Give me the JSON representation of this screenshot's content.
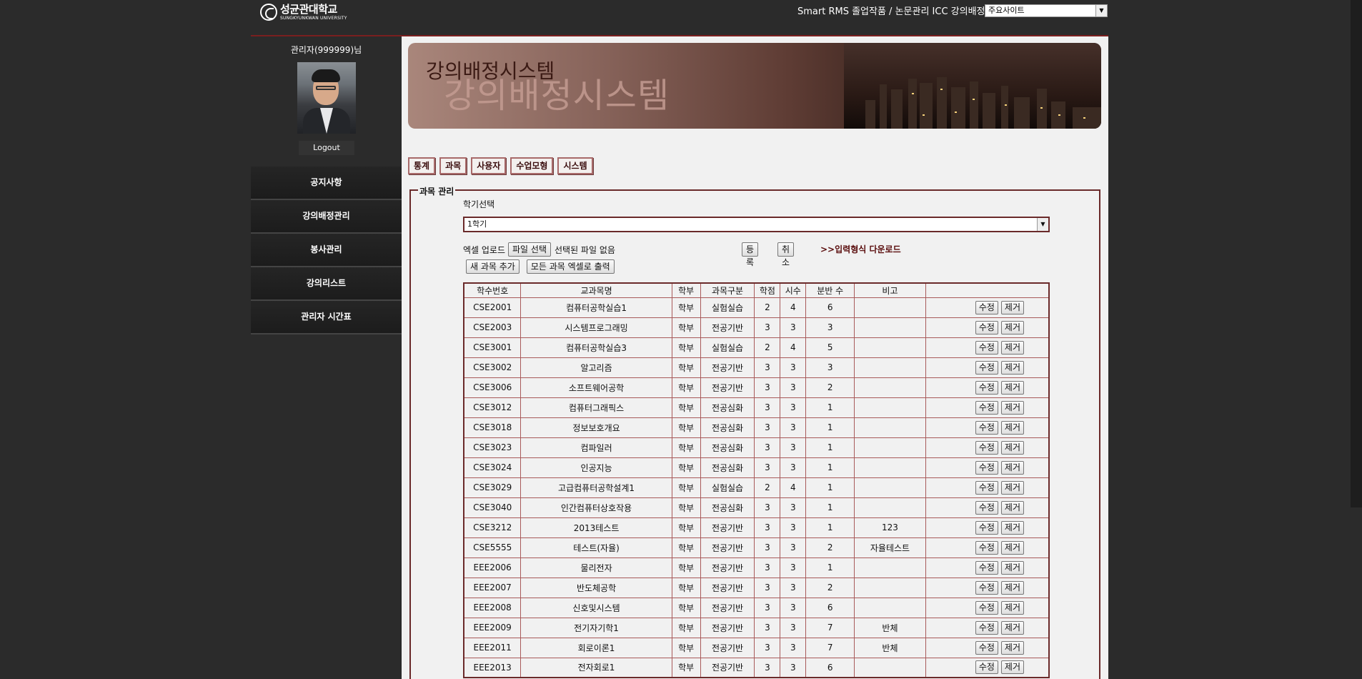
{
  "header": {
    "logo_text_ko": "성균관대학교",
    "logo_text_en": "SUNGKYUNKWAN UNIVERSITY",
    "links": "Smart RMS 졸업작품 / 논문관리 ICC 강의배정",
    "site_select": "주요사이트"
  },
  "sidebar": {
    "admin_name": "관리자(999999)님",
    "logout_label": "Logout",
    "menu": [
      "공지사항",
      "강의배정관리",
      "봉사관리",
      "강의리스트",
      "관리자 시간표"
    ]
  },
  "banner": {
    "title_small": "강의배정시스템",
    "title_big": "강의배정시스템"
  },
  "tabs": [
    "통계",
    "과목",
    "사용자",
    "수업모형",
    "시스템"
  ],
  "course_mgmt": {
    "legend": "과목 관리",
    "semester_label": "학기선택",
    "semester_value": "1학기",
    "upload_label": "엑셀 업로드",
    "file_button": "파일 선택",
    "no_file_text": "선택된 파일 없음",
    "register_button": "등록",
    "cancel_button": "취소",
    "download_link": ">>입력형식 다운로드",
    "add_course_button": "새 과목 추가",
    "export_button": "모든 과목 엑셀로 출력"
  },
  "table": {
    "headers": [
      "학수번호",
      "교과목명",
      "학부",
      "과목구분",
      "학점",
      "시수",
      "분반 수",
      "비고",
      ""
    ],
    "edit_label": "수정",
    "delete_label": "제거",
    "rows": [
      [
        "CSE2001",
        "컴퓨터공학실습1",
        "학부",
        "실험실습",
        "2",
        "4",
        "6",
        ""
      ],
      [
        "CSE2003",
        "시스템프로그래밍",
        "학부",
        "전공기반",
        "3",
        "3",
        "3",
        ""
      ],
      [
        "CSE3001",
        "컴퓨터공학실습3",
        "학부",
        "실험실습",
        "2",
        "4",
        "5",
        ""
      ],
      [
        "CSE3002",
        "알고리즘",
        "학부",
        "전공기반",
        "3",
        "3",
        "3",
        ""
      ],
      [
        "CSE3006",
        "소프트웨어공학",
        "학부",
        "전공기반",
        "3",
        "3",
        "2",
        ""
      ],
      [
        "CSE3012",
        "컴퓨터그래픽스",
        "학부",
        "전공심화",
        "3",
        "3",
        "1",
        ""
      ],
      [
        "CSE3018",
        "정보보호개요",
        "학부",
        "전공심화",
        "3",
        "3",
        "1",
        ""
      ],
      [
        "CSE3023",
        "컴파일러",
        "학부",
        "전공심화",
        "3",
        "3",
        "1",
        ""
      ],
      [
        "CSE3024",
        "인공지능",
        "학부",
        "전공심화",
        "3",
        "3",
        "1",
        ""
      ],
      [
        "CSE3029",
        "고급컴퓨터공학설계1",
        "학부",
        "실험실습",
        "2",
        "4",
        "1",
        ""
      ],
      [
        "CSE3040",
        "인간컴퓨터상호작용",
        "학부",
        "전공심화",
        "3",
        "3",
        "1",
        ""
      ],
      [
        "CSE3212",
        "2013테스트",
        "학부",
        "전공기반",
        "3",
        "3",
        "1",
        "123"
      ],
      [
        "CSE5555",
        "테스트(자율)",
        "학부",
        "전공기반",
        "3",
        "3",
        "2",
        "자율테스트"
      ],
      [
        "EEE2006",
        "물리전자",
        "학부",
        "전공기반",
        "3",
        "3",
        "1",
        ""
      ],
      [
        "EEE2007",
        "반도체공학",
        "학부",
        "전공기반",
        "3",
        "3",
        "2",
        ""
      ],
      [
        "EEE2008",
        "신호및시스템",
        "학부",
        "전공기반",
        "3",
        "3",
        "6",
        ""
      ],
      [
        "EEE2009",
        "전기자기학1",
        "학부",
        "전공기반",
        "3",
        "3",
        "7",
        "반체"
      ],
      [
        "EEE2011",
        "회로이론1",
        "학부",
        "전공기반",
        "3",
        "3",
        "7",
        "반체"
      ],
      [
        "EEE2013",
        "전자회로1",
        "학부",
        "전공기반",
        "3",
        "3",
        "6",
        ""
      ]
    ]
  }
}
